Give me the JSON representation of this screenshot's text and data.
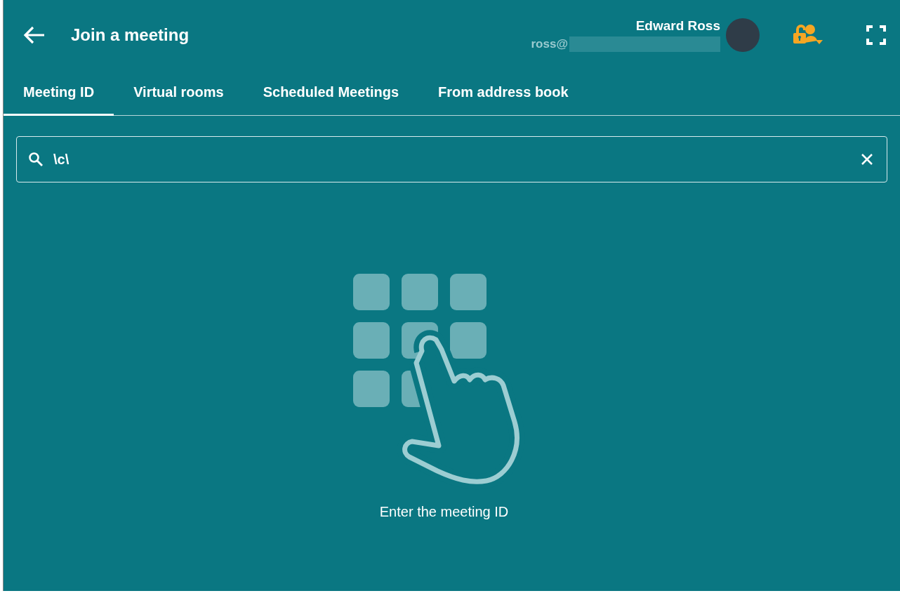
{
  "header": {
    "title": "Join a meeting",
    "user_name": "Edward Ross",
    "user_email": "ross@"
  },
  "tabs": [
    {
      "label": "Meeting ID",
      "selected": true
    },
    {
      "label": "Virtual rooms",
      "selected": false
    },
    {
      "label": "Scheduled Meetings",
      "selected": false
    },
    {
      "label": "From address book",
      "selected": false
    }
  ],
  "search": {
    "value": "\\c\\"
  },
  "empty_state": {
    "message": "Enter the meeting ID"
  }
}
